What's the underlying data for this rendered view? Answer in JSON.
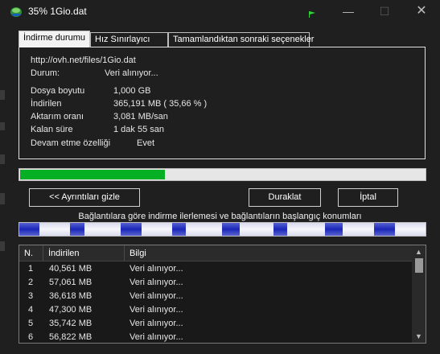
{
  "window": {
    "title": "35% 1Gio.dat"
  },
  "window_controls": {
    "minimize": "—",
    "maximize": "☐",
    "close": "✕"
  },
  "tabs": [
    {
      "label": "İndirme durumu"
    },
    {
      "label": "Hız Sınırlayıcı"
    },
    {
      "label": "Tamamlandıktan sonraki seçenekler"
    }
  ],
  "status": {
    "url": "http://ovh.net/files/1Gio.dat",
    "state_label": "Durum:",
    "state_value": "Veri alınıyor...",
    "file_size_label": "Dosya boyutu",
    "file_size_value": "1,000  GB",
    "downloaded_label": "İndirilen",
    "downloaded_value": "365,191  MB  ( 35,66 % )",
    "rate_label": "Aktarım oranı",
    "rate_value": "3,081  MB/san",
    "remaining_label": "Kalan süre",
    "remaining_value": "1 dak 55 san",
    "resume_label": "Devam etme özelliği",
    "resume_value": "Evet"
  },
  "progress": {
    "percent": 35.66,
    "color": "#06b025"
  },
  "buttons": {
    "details": "<< Ayrıntıları gizle",
    "pause": "Duraklat",
    "cancel": "İptal"
  },
  "connections_caption": "Bağlantılara göre indirme ilerlemesi ve bağlantıların başlangıç konumları",
  "connection_progress_color": "#1a27b8",
  "table": {
    "columns": [
      "N.",
      "İndirilen",
      "Bilgi"
    ],
    "rows": [
      {
        "n": "1",
        "downloaded": "40,561  MB",
        "info": "Veri alınıyor..."
      },
      {
        "n": "2",
        "downloaded": "57,061  MB",
        "info": "Veri alınıyor..."
      },
      {
        "n": "3",
        "downloaded": "36,618  MB",
        "info": "Veri alınıyor..."
      },
      {
        "n": "4",
        "downloaded": "47,300  MB",
        "info": "Veri alınıyor..."
      },
      {
        "n": "5",
        "downloaded": "35,742  MB",
        "info": "Veri alınıyor..."
      },
      {
        "n": "6",
        "downloaded": "56,822  MB",
        "info": "Veri alınıyor..."
      }
    ]
  },
  "icons": {
    "app": "idm-globe-icon",
    "flag": "green-flag-icon",
    "scroll_up": "chevron-up-icon",
    "scroll_down": "chevron-down-icon"
  }
}
